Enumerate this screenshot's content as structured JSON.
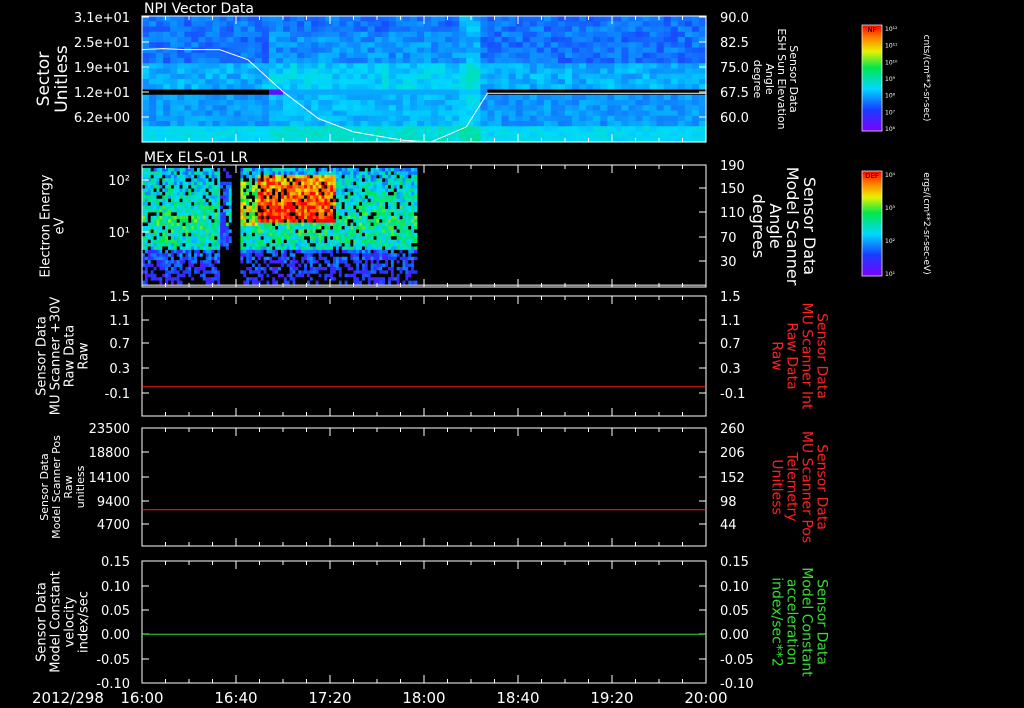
{
  "time_axis": {
    "date_label": "2012/298",
    "ticks": [
      "16:00",
      "16:40",
      "17:20",
      "18:00",
      "18:40",
      "19:20",
      "20:00"
    ],
    "range_hours": [
      16.0,
      20.0
    ]
  },
  "colors": {
    "background": "#000000",
    "axes": "#ffffff",
    "red_trace": "#ff2020",
    "green_trace": "#33dd33",
    "spectrogram_low": "#5a16d8",
    "spectrogram_high": "#ff0000"
  },
  "chart_data": [
    {
      "type": "heatmap",
      "title": "NPI Vector Data",
      "ylabel": [
        "Sector",
        "Unitless"
      ],
      "yticks": [
        "3.1e+01",
        "2.5e+01",
        "1.9e+01",
        "1.2e+01",
        "6.2e+00"
      ],
      "right_axis": {
        "label": [
          "Sensor Data",
          "ESH Sun Elevation",
          "Angle",
          "degree"
        ],
        "ticks": [
          "90.0",
          "82.5",
          "75.0",
          "67.5",
          "60.0"
        ],
        "range": [
          52.5,
          90.0
        ]
      },
      "overlay_line": {
        "axis": "right",
        "x": [
          16.0,
          16.15,
          16.3,
          16.55,
          16.75,
          17.0,
          17.25,
          17.5,
          17.85,
          18.05,
          18.3,
          18.45,
          20.0
        ],
        "y": [
          80.0,
          80.3,
          80.0,
          80.0,
          77.0,
          67.5,
          59.5,
          55.5,
          53.0,
          52.5,
          57.0,
          67.0,
          67.0
        ]
      },
      "colorbar": {
        "label": "NF",
        "units": "cnts/(cm**2-sr-sec)",
        "ticks": [
          "10¹²",
          "10¹¹",
          "10¹⁰",
          "10⁹",
          "10⁸",
          "10⁷",
          "10⁶"
        ]
      }
    },
    {
      "type": "heatmap",
      "title": "MEx ELS-01 LR",
      "ylabel": [
        "Electron Energy",
        "eV"
      ],
      "yticks": [
        "10²",
        "10¹"
      ],
      "data_coverage_hours": [
        16.0,
        17.95
      ],
      "right_axis": {
        "label": [
          "Sensor Data",
          "Model Scanner",
          "Angle",
          "degrees"
        ],
        "ticks": [
          "190",
          "150",
          "110",
          "70",
          "30"
        ],
        "range": [
          0,
          190
        ]
      },
      "overlay_line": {
        "axis": "right",
        "x": [
          16.0,
          20.0
        ],
        "y": [
          3,
          3
        ]
      },
      "colorbar": {
        "label": "DEF",
        "units": "ergs/(cm**2-sr-sec-eV)",
        "ticks": [
          "10⁴",
          "10³",
          "10²",
          "10¹"
        ]
      }
    },
    {
      "type": "line",
      "ylabel": [
        "Sensor Data",
        "MU Scanner +30V",
        "Raw Data",
        "Raw"
      ],
      "yticks": [
        "1.5",
        "1.1",
        "0.7",
        "0.3",
        "-0.1"
      ],
      "ylim": [
        -0.35,
        1.5
      ],
      "right_axis": {
        "label": [
          "Sensor Data",
          "MU Scanner Int",
          "Raw Data",
          "Raw"
        ],
        "ticks": [
          "1.5",
          "1.1",
          "0.7",
          "0.3",
          "-0.1"
        ],
        "range": [
          -0.35,
          1.5
        ]
      },
      "series": [
        {
          "color": "red",
          "x": [
            16.0,
            20.0
          ],
          "values": [
            0.1,
            0.1
          ]
        }
      ]
    },
    {
      "type": "line",
      "ylabel": [
        "Sensor Data",
        "Model Scanner Pos",
        "Raw",
        "unitless"
      ],
      "yticks": [
        "23500",
        "18800",
        "14100",
        "9400",
        "4700"
      ],
      "ylim": [
        0,
        23500
      ],
      "right_axis": {
        "label": [
          "Sensor Data",
          "MU Scanner Pos",
          "Telemetry",
          "Unitless"
        ],
        "ticks": [
          "260",
          "206",
          "152",
          "98",
          "44"
        ],
        "range": [
          0,
          260
        ]
      },
      "series": [
        {
          "color": "red",
          "x": [
            16.0,
            20.0
          ],
          "values": [
            7200,
            7200
          ]
        }
      ]
    },
    {
      "type": "line",
      "ylabel": [
        "Sensor Data",
        "Model Constant",
        "velocity",
        "index/sec"
      ],
      "yticks": [
        "0.15",
        "0.10",
        "0.05",
        "0.00",
        "-0.05",
        "-0.10"
      ],
      "ylim": [
        -0.1,
        0.15
      ],
      "right_axis": {
        "label": [
          "Sensor Data",
          "Model Constant",
          "acceleration",
          "index/sec**2"
        ],
        "ticks": [
          "0.15",
          "0.10",
          "0.05",
          "0.00",
          "-0.05",
          "-0.10"
        ],
        "range": [
          -0.1,
          0.15
        ]
      },
      "series": [
        {
          "color": "green",
          "x": [
            16.0,
            20.0
          ],
          "values": [
            0.0,
            0.0
          ]
        }
      ]
    }
  ]
}
